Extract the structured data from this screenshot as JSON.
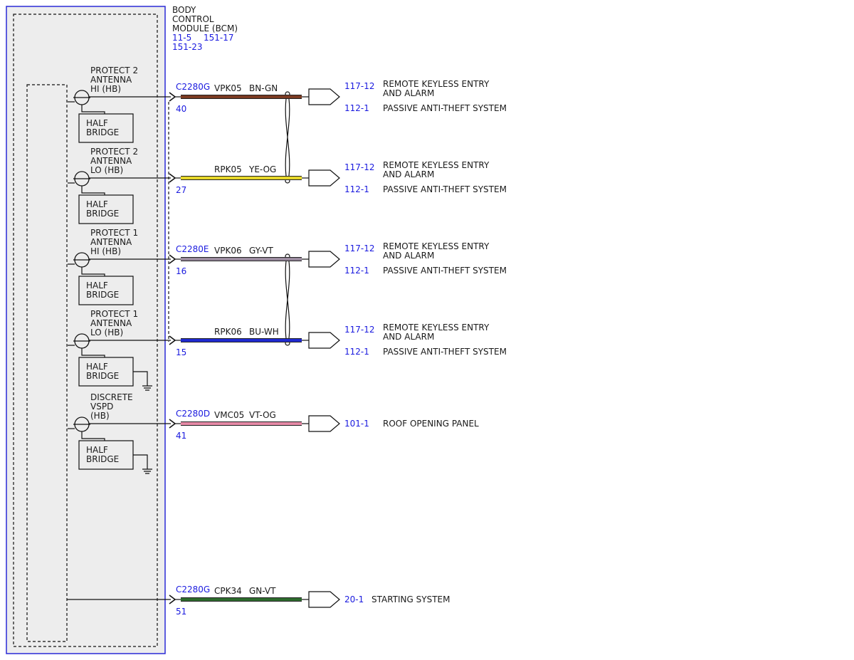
{
  "module": {
    "title_lines": [
      "BODY",
      "CONTROL",
      "MODULE (BCM)"
    ],
    "refs": [
      "11-5",
      "151-17",
      "151-23"
    ]
  },
  "colors": {
    "module_border": "#2a2ad6",
    "module_fill": "#ededed",
    "ref_text": "#1a1adf",
    "BN-GN": "#7b3a22",
    "YE-OG": "#e6d72a",
    "GY-VT": "#9a8a9e",
    "BU-WH": "#1f2ad1",
    "VT-OG": "#e58aa6",
    "GN-VT": "#2d6b2d"
  },
  "circuits": [
    {
      "signal_lines": [
        "PROTECT 2",
        "ANTENNA",
        "HI (HB)"
      ],
      "half_bridge_lines": [
        "HALF",
        "BRIDGE"
      ],
      "ground": false,
      "connector": "C2280G",
      "pin": "40",
      "circuit": "VPK05",
      "wire_color": "BN-GN",
      "destinations": [
        {
          "ref": "117-12",
          "lines": [
            "REMOTE KEYLESS ENTRY",
            "AND ALARM"
          ]
        },
        {
          "ref": "112-1",
          "lines": [
            "PASSIVE ANTI-THEFT SYSTEM"
          ]
        }
      ]
    },
    {
      "signal_lines": [
        "PROTECT 2",
        "ANTENNA",
        "LO (HB)"
      ],
      "half_bridge_lines": [
        "HALF",
        "BRIDGE"
      ],
      "ground": false,
      "connector": "",
      "pin": "27",
      "circuit": "RPK05",
      "wire_color": "YE-OG",
      "destinations": [
        {
          "ref": "117-12",
          "lines": [
            "REMOTE KEYLESS ENTRY",
            "AND ALARM"
          ]
        },
        {
          "ref": "112-1",
          "lines": [
            "PASSIVE ANTI-THEFT SYSTEM"
          ]
        }
      ]
    },
    {
      "signal_lines": [
        "PROTECT 1",
        "ANTENNA",
        "HI (HB)"
      ],
      "half_bridge_lines": [
        "HALF",
        "BRIDGE"
      ],
      "ground": false,
      "connector": "C2280E",
      "pin": "16",
      "circuit": "VPK06",
      "wire_color": "GY-VT",
      "destinations": [
        {
          "ref": "117-12",
          "lines": [
            "REMOTE KEYLESS ENTRY",
            "AND ALARM"
          ]
        },
        {
          "ref": "112-1",
          "lines": [
            "PASSIVE ANTI-THEFT SYSTEM"
          ]
        }
      ]
    },
    {
      "signal_lines": [
        "PROTECT 1",
        "ANTENNA",
        "LO (HB)"
      ],
      "half_bridge_lines": [
        "HALF",
        "BRIDGE"
      ],
      "ground": true,
      "connector": "",
      "pin": "15",
      "circuit": "RPK06",
      "wire_color": "BU-WH",
      "destinations": [
        {
          "ref": "117-12",
          "lines": [
            "REMOTE KEYLESS ENTRY",
            "AND ALARM"
          ]
        },
        {
          "ref": "112-1",
          "lines": [
            "PASSIVE ANTI-THEFT SYSTEM"
          ]
        }
      ]
    },
    {
      "signal_lines": [
        "DISCRETE",
        "VSPD",
        "(HB)"
      ],
      "half_bridge_lines": [
        "HALF",
        "BRIDGE"
      ],
      "ground": true,
      "connector": "C2280D",
      "pin": "41",
      "circuit": "VMC05",
      "wire_color": "VT-OG",
      "destinations": [
        {
          "ref": "101-1",
          "lines": [
            "ROOF OPENING PANEL"
          ]
        }
      ]
    },
    {
      "signal_lines": [],
      "half_bridge_lines": [],
      "ground": false,
      "connector": "C2280G",
      "pin": "51",
      "circuit": "CPK34",
      "wire_color": "GN-VT",
      "destinations": [
        {
          "ref": "20-1",
          "lines": [
            "STARTING SYSTEM"
          ]
        }
      ]
    }
  ]
}
